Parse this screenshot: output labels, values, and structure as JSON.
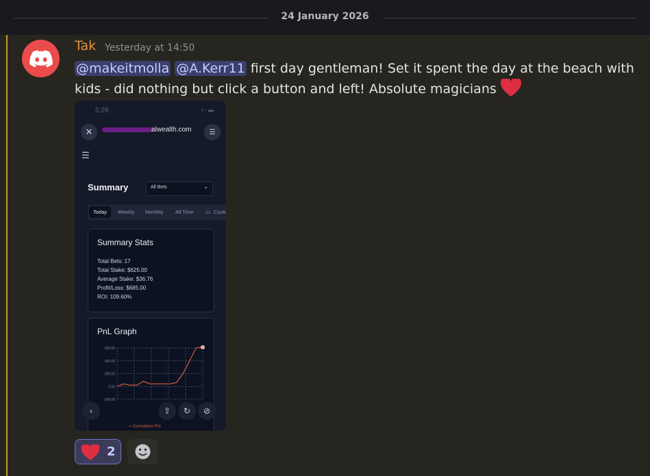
{
  "divider": {
    "date": "24 January 2026"
  },
  "message": {
    "author": "Tak",
    "timestamp": "Yesterday at 14:50",
    "mention1": "@makeitmolla",
    "mention2": "@A.Kerr11",
    "text_part1": " first day gentleman! Set it spent the day at the beach with kids - did nothing but click a button and left! Absolute magicians ",
    "emoji": "heart"
  },
  "attachment": {
    "status_time": "5:29",
    "url": "alwealth.com",
    "page_title": "Summary",
    "select_value": "All Bets",
    "tabs": [
      "Today",
      "Weekly",
      "Monthly",
      "All Time",
      "Custo"
    ],
    "stats_card": {
      "title": "Summary Stats",
      "total_bets": "Total Bets: 17",
      "total_stake": "Total Stake: $625.00",
      "average_stake": "Average Stake: $36.76",
      "profit_loss": "Profit/Loss: $685.00",
      "roi": "ROI: 109.60%"
    },
    "graph_card": {
      "title": "PnL Graph",
      "legend": "Cumulative PnL"
    }
  },
  "chart_data": {
    "type": "line",
    "title": "PnL Graph",
    "series": [
      {
        "name": "Cumulative PnL",
        "values": [
          0,
          40,
          20,
          20,
          80,
          40,
          40,
          40,
          40,
          60,
          200,
          400,
          600,
          610
        ]
      }
    ],
    "ylim": [
      -200,
      600
    ],
    "yticks": [
      "600.00",
      "400.00",
      "200.00",
      "0.00",
      "-200.00"
    ],
    "grid": true,
    "color": "#c8573a"
  },
  "reactions": [
    {
      "emoji": "heart",
      "count": "2"
    }
  ],
  "colors": {
    "author": "#e8923c",
    "mention_bg": "#3b3f6d",
    "avatar": "#ea4b4b",
    "accent_bar": "#c99a2e"
  }
}
